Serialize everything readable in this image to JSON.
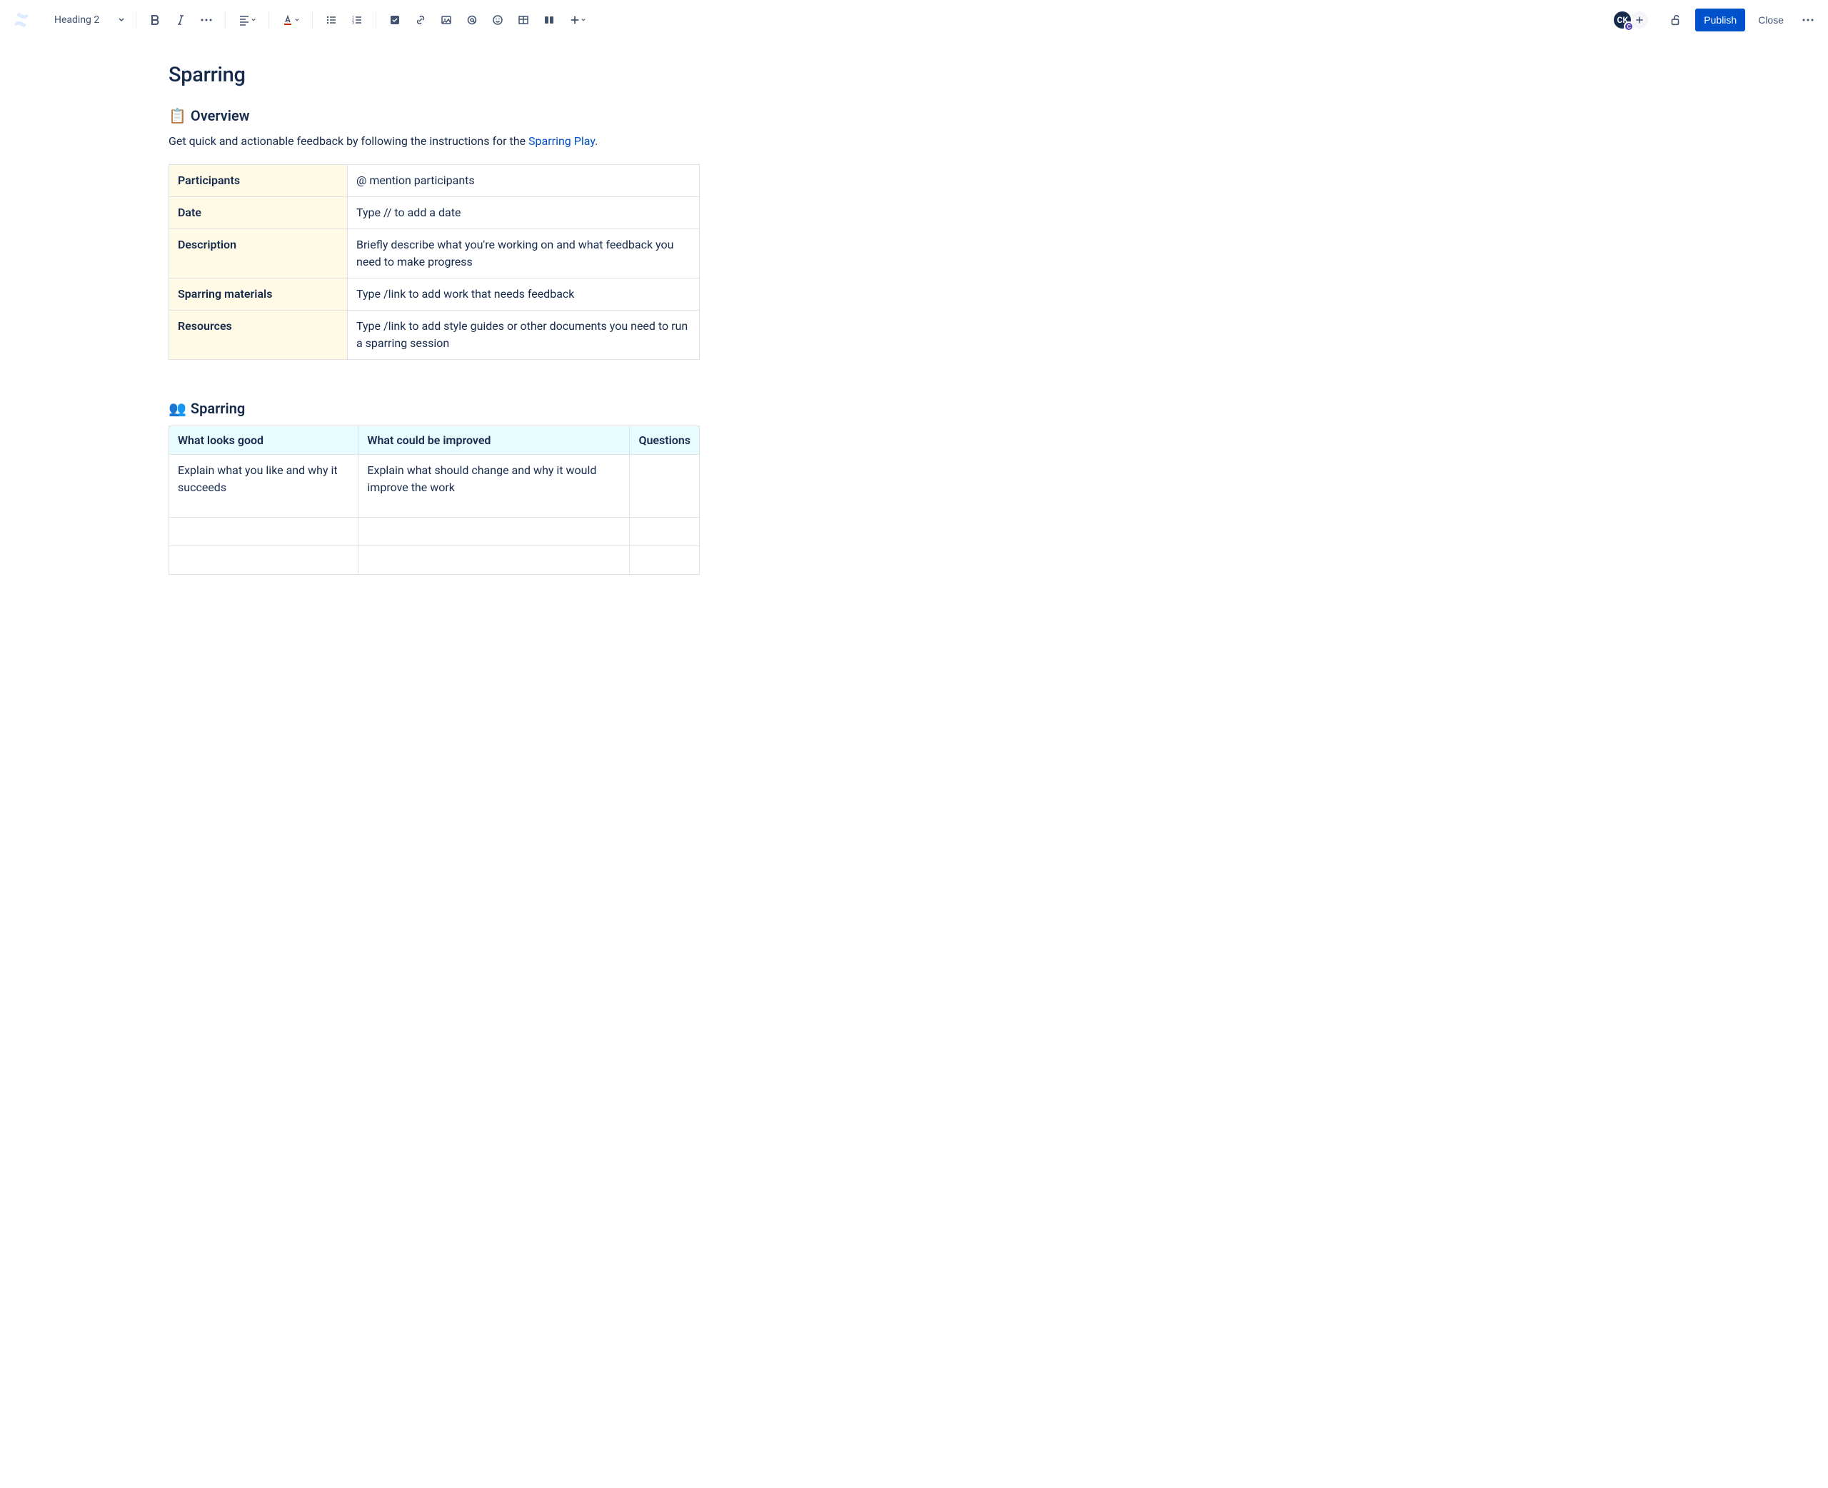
{
  "toolbar": {
    "text_style": "Heading 2",
    "publish_label": "Publish",
    "close_label": "Close"
  },
  "avatar": {
    "initials": "CK",
    "badge": "C"
  },
  "page": {
    "title": "Sparring"
  },
  "overview": {
    "icon": "📋",
    "heading": "Overview",
    "intro_prefix": "Get quick and actionable feedback by following the instructions for the ",
    "intro_link": "Sparring Play",
    "intro_suffix": ".",
    "rows": [
      {
        "k": "Participants",
        "v": "@ mention participants"
      },
      {
        "k": "Date",
        "v": "Type // to add a date"
      },
      {
        "k": "Description",
        "v": "Briefly describe what you're working on and what feedback you need to make progress"
      },
      {
        "k": "Sparring materials",
        "v": "Type /link to add work that needs feedback"
      },
      {
        "k": "Resources",
        "v": "Type /link to add style guides or other documents you need to run a sparring session"
      }
    ]
  },
  "sparring": {
    "icon": "👥",
    "heading": "Sparring",
    "columns": [
      "What looks good",
      "What could be improved",
      "Questions"
    ],
    "rows": [
      [
        "Explain what you like and why it succeeds",
        "Explain what should change and why it would improve the work",
        ""
      ],
      [
        "",
        "",
        ""
      ],
      [
        "",
        "",
        ""
      ]
    ]
  }
}
